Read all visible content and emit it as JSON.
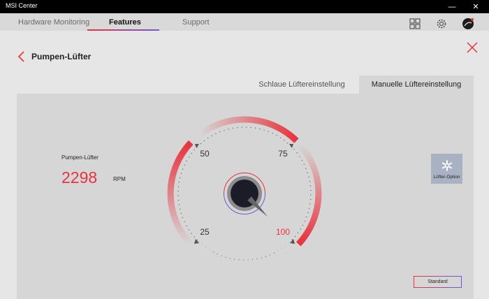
{
  "window": {
    "title": "MSI Center",
    "minimize": "—",
    "close": "✕"
  },
  "nav": {
    "tabs": [
      "Hardware Monitoring",
      "Features",
      "Support"
    ],
    "active": 1
  },
  "page": {
    "title": "Pumpen-Lüfter"
  },
  "mode_tabs": [
    "Schlaue Lüftereinstellung",
    "Manuelle Lüftereinstellung"
  ],
  "readout": {
    "label": "Pumpen-Lüfter",
    "value": "2298",
    "unit": "RPM"
  },
  "gauge": {
    "ticks": [
      "25",
      "50",
      "75",
      "100"
    ],
    "value_percent": 100
  },
  "fan_option": {
    "label": "Lüfter-Option",
    "icon": "fan-icon"
  },
  "standard_button": {
    "label": "Standard"
  },
  "colors": {
    "accent_red": "#e8323c",
    "accent_blue": "#6b5bd8"
  }
}
